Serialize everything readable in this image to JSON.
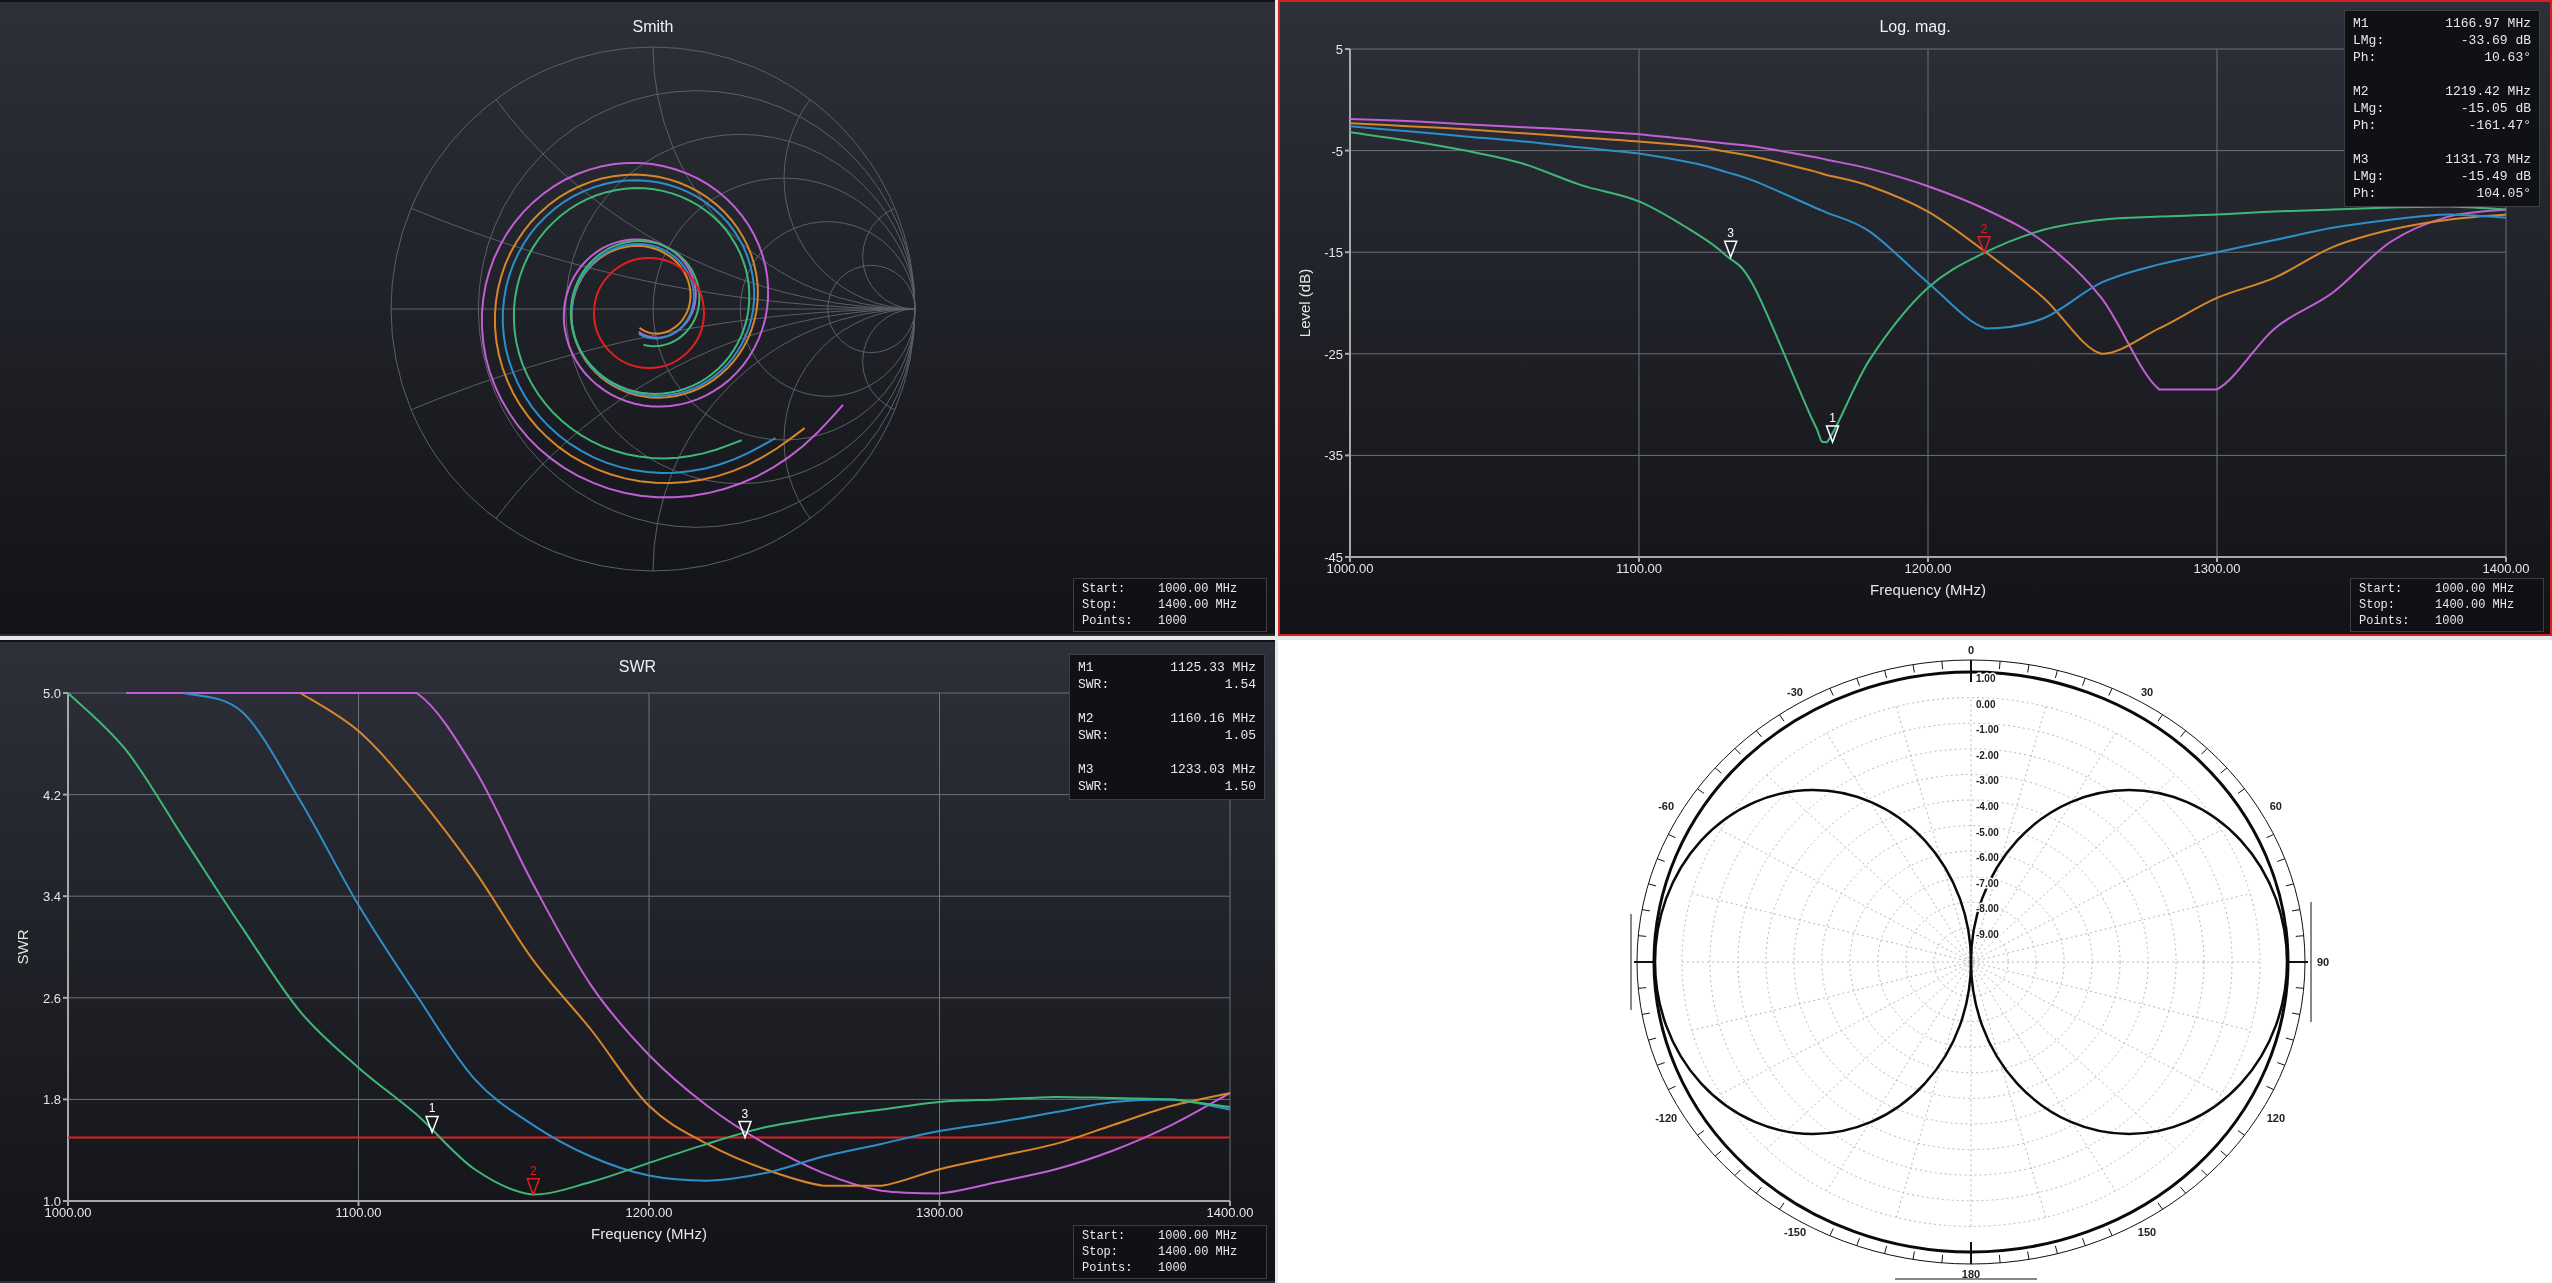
{
  "smith_panel": {
    "title": "Smith",
    "selected": false,
    "sweep": [
      {
        "label": "Start:",
        "value": "1000.00 MHz"
      },
      {
        "label": "Stop:",
        "value": "1400.00 MHz"
      },
      {
        "label": "Points:",
        "value": "1000"
      }
    ]
  },
  "logmag_panel": {
    "selected": true,
    "markers": [
      {
        "name": "M1",
        "frequency": "1166.97 MHz",
        "selected": false,
        "readings": [
          {
            "label": "LMg:",
            "value": "-33.69 dB"
          },
          {
            "label": "Ph:",
            "value": "10.63°"
          }
        ]
      },
      {
        "name": "M2",
        "frequency": "1219.42 MHz",
        "selected": true,
        "readings": [
          {
            "label": "LMg:",
            "value": "-15.05 dB"
          },
          {
            "label": "Ph:",
            "value": "-161.47°"
          }
        ]
      },
      {
        "name": "M3",
        "frequency": "1131.73 MHz",
        "selected": false,
        "readings": [
          {
            "label": "LMg:",
            "value": "-15.49 dB"
          },
          {
            "label": "Ph:",
            "value": "104.05°"
          }
        ]
      }
    ],
    "sweep": [
      {
        "label": "Start:",
        "value": "1000.00 MHz"
      },
      {
        "label": "Stop:",
        "value": "1400.00 MHz"
      },
      {
        "label": "Points:",
        "value": "1000"
      }
    ],
    "chart_data": {
      "type": "line",
      "title": "Log. mag.",
      "xlabel": "Frequency (MHz)",
      "ylabel": "Level (dB)",
      "grid": true,
      "x": [
        1000,
        1020,
        1040,
        1060,
        1080,
        1100,
        1120,
        1130,
        1140,
        1160,
        1165,
        1180,
        1200,
        1220,
        1240,
        1260,
        1280,
        1300,
        1320,
        1340,
        1360,
        1380,
        1400
      ],
      "xlim": [
        1000,
        1400
      ],
      "ylim": [
        -45,
        5
      ],
      "xticks": [
        {
          "value": 1000,
          "label": "1000.00"
        },
        {
          "value": 1100,
          "label": "1100.00"
        },
        {
          "value": 1200,
          "label": "1200.00"
        },
        {
          "value": 1300,
          "label": "1300.00"
        },
        {
          "value": 1400,
          "label": "1400.00"
        }
      ],
      "yticks": [
        5,
        -5,
        -15,
        -25,
        -35,
        -45
      ],
      "series": [
        {
          "color": "#3fb777",
          "values": [
            -3.2,
            -4.0,
            -5.0,
            -6.3,
            -8.4,
            -10.0,
            -13.2,
            -15.3,
            -18.5,
            -31.5,
            -33.7,
            -25.5,
            -18.5,
            -15.0,
            -12.8,
            -11.8,
            -11.5,
            -11.3,
            -11.0,
            -10.8,
            -10.6,
            -10.5,
            -10.8
          ]
        },
        {
          "color": "#2d8fca",
          "values": [
            -2.6,
            -3.1,
            -3.6,
            -4.1,
            -4.7,
            -5.3,
            -6.3,
            -7.1,
            -8.0,
            -10.5,
            -11.1,
            -13.0,
            -18.0,
            -22.5,
            -21.5,
            -18.0,
            -16.2,
            -15.0,
            -13.8,
            -12.6,
            -11.8,
            -11.3,
            -11.6
          ]
        },
        {
          "color": "#d8862a",
          "values": [
            -2.3,
            -2.6,
            -2.9,
            -3.3,
            -3.7,
            -4.1,
            -4.6,
            -5.1,
            -5.6,
            -7.0,
            -7.4,
            -8.5,
            -11.0,
            -15.0,
            -19.5,
            -25.0,
            -22.5,
            -19.5,
            -17.5,
            -14.5,
            -12.8,
            -11.8,
            -11.3
          ]
        },
        {
          "color": "#c35fd6",
          "values": [
            -1.9,
            -2.1,
            -2.4,
            -2.7,
            -3.0,
            -3.4,
            -4.0,
            -4.3,
            -4.6,
            -5.6,
            -5.9,
            -6.8,
            -8.5,
            -10.8,
            -14.0,
            -19.5,
            -28.5,
            -28.5,
            -22.5,
            -19.0,
            -14.0,
            -11.5,
            -10.8
          ]
        }
      ],
      "annotations": [
        {
          "x": 1166.97,
          "y": -33.69,
          "text": "1"
        },
        {
          "x": 1219.42,
          "y": -15.05,
          "text": "2"
        },
        {
          "x": 1131.73,
          "y": -15.49,
          "text": "3"
        }
      ]
    }
  },
  "swr_panel": {
    "selected": false,
    "markers": [
      {
        "name": "M1",
        "frequency": "1125.33 MHz",
        "selected": false,
        "readings": [
          {
            "label": "SWR:",
            "value": "1.54"
          }
        ]
      },
      {
        "name": "M2",
        "frequency": "1160.16 MHz",
        "selected": true,
        "readings": [
          {
            "label": "SWR:",
            "value": "1.05"
          }
        ]
      },
      {
        "name": "M3",
        "frequency": "1233.03 MHz",
        "selected": false,
        "readings": [
          {
            "label": "SWR:",
            "value": "1.50"
          }
        ]
      }
    ],
    "sweep": [
      {
        "label": "Start:",
        "value": "1000.00 MHz"
      },
      {
        "label": "Stop:",
        "value": "1400.00 MHz"
      },
      {
        "label": "Points:",
        "value": "1000"
      }
    ],
    "chart_data": {
      "type": "line",
      "title": "SWR",
      "xlabel": "Frequency (MHz)",
      "ylabel": "SWR",
      "grid": true,
      "x": [
        1000,
        1020,
        1040,
        1060,
        1080,
        1100,
        1120,
        1140,
        1160,
        1180,
        1200,
        1220,
        1240,
        1260,
        1280,
        1300,
        1320,
        1340,
        1360,
        1380,
        1400
      ],
      "xlim": [
        1000,
        1400
      ],
      "ylim": [
        1,
        5
      ],
      "xticks": [
        {
          "value": 1000,
          "label": "1000.00"
        },
        {
          "value": 1100,
          "label": "1100.00"
        },
        {
          "value": 1200,
          "label": "1200.00"
        },
        {
          "value": 1300,
          "label": "1300.00"
        },
        {
          "value": 1400,
          "label": "1400.00"
        }
      ],
      "yticks": [
        {
          "value": 5,
          "label": "5.0"
        },
        {
          "value": 4.2,
          "label": "4.2"
        },
        {
          "value": 3.4,
          "label": "3.4"
        },
        {
          "value": 2.6,
          "label": "2.6"
        },
        {
          "value": 1.8,
          "label": "1.8"
        },
        {
          "value": 1,
          "label": "1.0"
        }
      ],
      "series": [
        {
          "color": "#3fb777",
          "values": [
            5.0,
            4.55,
            3.85,
            3.15,
            2.49,
            2.05,
            1.68,
            1.25,
            1.05,
            1.15,
            1.3,
            1.45,
            1.58,
            1.66,
            1.72,
            1.78,
            1.8,
            1.82,
            1.81,
            1.8,
            1.74
          ]
        },
        {
          "color": "#2d8fca",
          "values": [
            null,
            null,
            5.0,
            4.85,
            4.15,
            3.33,
            2.62,
            1.96,
            1.6,
            1.35,
            1.2,
            1.16,
            1.22,
            1.35,
            1.45,
            1.55,
            1.62,
            1.7,
            1.78,
            1.8,
            1.72
          ]
        },
        {
          "color": "#d8862a",
          "values": [
            null,
            null,
            null,
            null,
            5.0,
            4.7,
            4.2,
            3.6,
            2.9,
            2.35,
            1.75,
            1.45,
            1.25,
            1.12,
            1.12,
            1.25,
            1.35,
            1.45,
            1.6,
            1.75,
            1.85
          ]
        },
        {
          "color": "#c35fd6",
          "values": [
            null,
            5.0,
            5.0,
            5.0,
            5.0,
            5.0,
            5.0,
            4.4,
            3.5,
            2.7,
            2.15,
            1.75,
            1.45,
            1.22,
            1.08,
            1.06,
            1.15,
            1.25,
            1.4,
            1.6,
            1.85
          ]
        },
        {
          "color": "#e0201f",
          "values": [
            1.5,
            1.5,
            1.5,
            1.5,
            1.5,
            1.5,
            1.5,
            1.5,
            1.5,
            1.5,
            1.5,
            1.5,
            1.5,
            1.5,
            1.5,
            1.5,
            1.5,
            1.5,
            1.5,
            1.5,
            1.5
          ]
        }
      ],
      "annotations": [
        {
          "x": 1125.33,
          "y": 1.54,
          "text": "1"
        },
        {
          "x": 1160.16,
          "y": 1.05,
          "text": "2"
        },
        {
          "x": 1233.03,
          "y": 1.5,
          "text": "3"
        }
      ]
    }
  },
  "polar_panel": {
    "angle_labels": [
      "0",
      "-30",
      "30",
      "-60",
      "60",
      "90",
      "-120",
      "120",
      "-150",
      "150",
      "180"
    ],
    "radial_labels": [
      "1.00",
      "0.00",
      "-1.00",
      "-2.00",
      "-3.00",
      "-4.00",
      "-5.00",
      "-6.00",
      "-7.00",
      "-8.00",
      "-9.00"
    ]
  }
}
